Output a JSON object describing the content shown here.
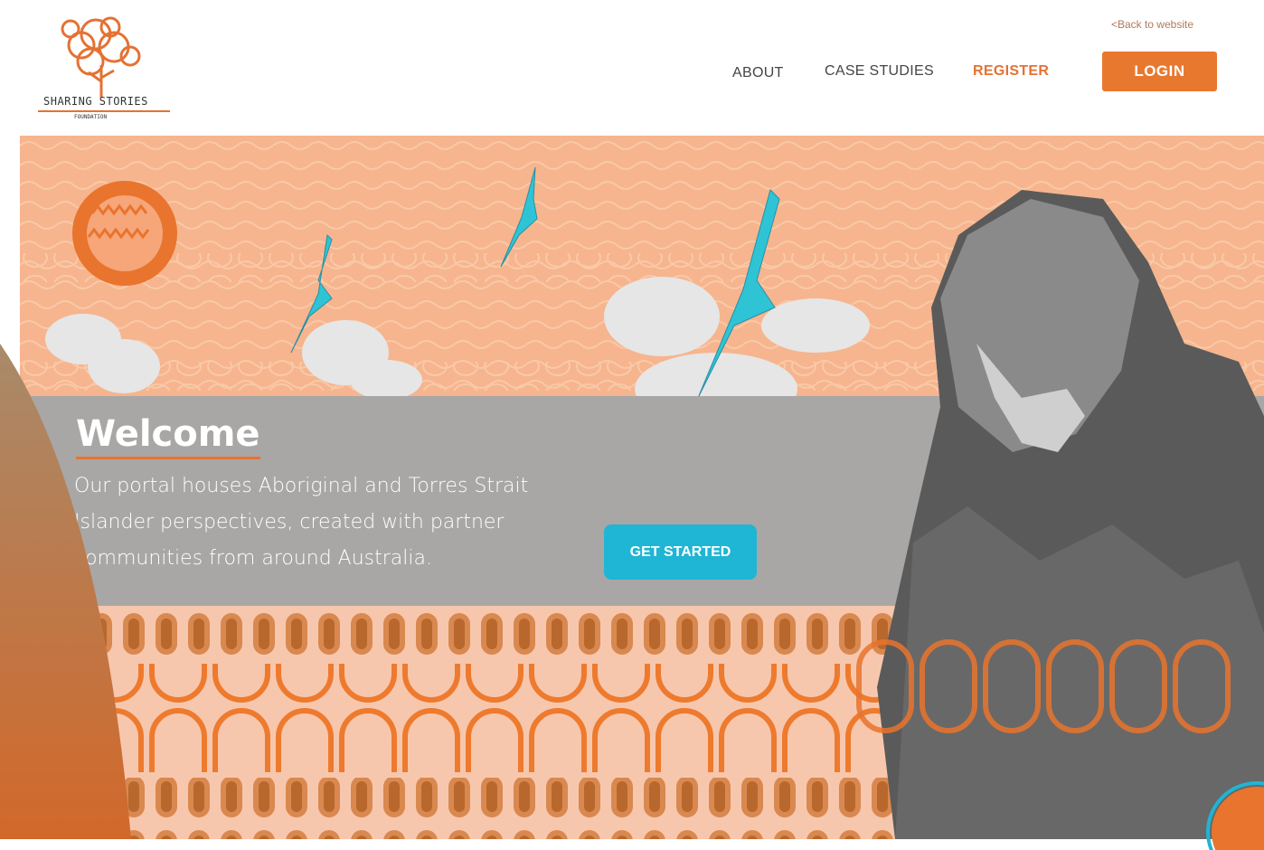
{
  "brand": {
    "logo_main": "SHARING STORIES",
    "logo_sub": "FOUNDATION"
  },
  "header": {
    "back_link": "<Back to website",
    "nav": {
      "about": "ABOUT",
      "case_studies": "CASE STUDIES",
      "register": "REGISTER",
      "login": "LOGIN"
    }
  },
  "hero": {
    "title": "Welcome",
    "intro": "Our portal houses Aboriginal and Torres Strait Islander perspectives, created with partner communities from around Australia.",
    "cta_label": "GET STARTED"
  },
  "colors": {
    "accent_orange": "#e9782f",
    "cta_cyan": "#1fb5d4",
    "sky_peach": "#f6b58e",
    "band_grey": "#a8a7a6"
  },
  "icons": [
    "tree-logo-icon",
    "sun-icon",
    "eagle-icon",
    "cloud-icon"
  ]
}
